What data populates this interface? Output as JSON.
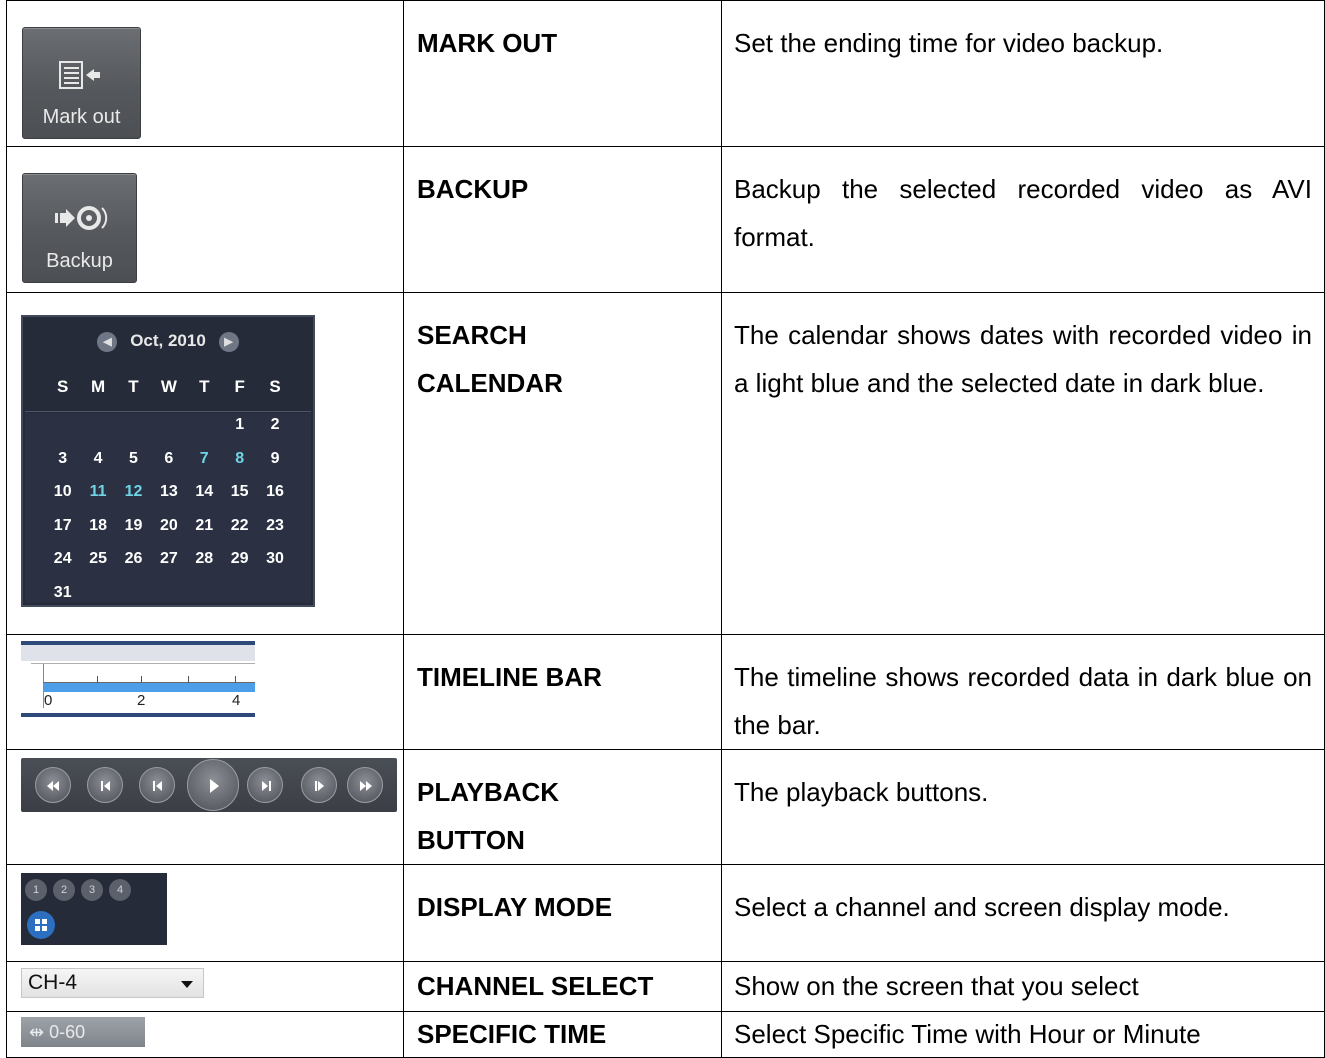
{
  "rows": [
    {
      "name": "MARK OUT",
      "desc": "Set the ending time for video backup.",
      "icon_label": "Mark out"
    },
    {
      "name": "BACKUP",
      "desc": "Backup the selected recorded video as AVI format.",
      "icon_label": "Backup"
    },
    {
      "name_line1": "SEARCH",
      "name_line2": "CALENDAR",
      "desc": "The calendar shows dates with recorded video in a light blue and the selected date in dark blue."
    },
    {
      "name": "TIMELINE BAR",
      "desc": "The timeline shows recorded data in dark blue on the bar."
    },
    {
      "name_line1": "PLAYBACK",
      "name_line2": "BUTTON",
      "desc": "The playback buttons."
    },
    {
      "name": "DISPLAY MODE",
      "desc": "Select a channel and screen display mode."
    },
    {
      "name": "CHANNEL SELECT",
      "desc": "Show on the screen that you select"
    },
    {
      "name": "SPECIFIC TIME",
      "desc": "Select Specific Time with Hour or Minute"
    }
  ],
  "calendar": {
    "month": "Oct, 2010",
    "weekdays": [
      "S",
      "M",
      "T",
      "W",
      "T",
      "F",
      "S"
    ],
    "days": [
      "",
      "",
      "",
      "",
      "",
      "1",
      "2",
      "3",
      "4",
      "5",
      "6",
      "7",
      "8",
      "9",
      "10",
      "11",
      "12",
      "13",
      "14",
      "15",
      "16",
      "17",
      "18",
      "19",
      "20",
      "21",
      "22",
      "23",
      "24",
      "25",
      "26",
      "27",
      "28",
      "29",
      "30",
      "31"
    ],
    "recorded_days": [
      "7",
      "8",
      "11",
      "12"
    ],
    "recorded_color": "#6fd4e6"
  },
  "timeline": {
    "labels": [
      "0",
      "2",
      "4"
    ],
    "recorded_color": "#4d9ee8"
  },
  "playback": {
    "icons": [
      "fast-rewind-icon",
      "step-back-icon",
      "skip-back-icon",
      "play-icon",
      "skip-forward-icon",
      "step-forward-icon",
      "fast-forward-icon"
    ]
  },
  "display_mode": {
    "channels": [
      "1",
      "2",
      "3",
      "4"
    ],
    "grid_icon": "quad-grid-icon"
  },
  "channel_select": {
    "value": "CH-4"
  },
  "specific_time": {
    "value": "0-60",
    "icon": "range-icon"
  }
}
